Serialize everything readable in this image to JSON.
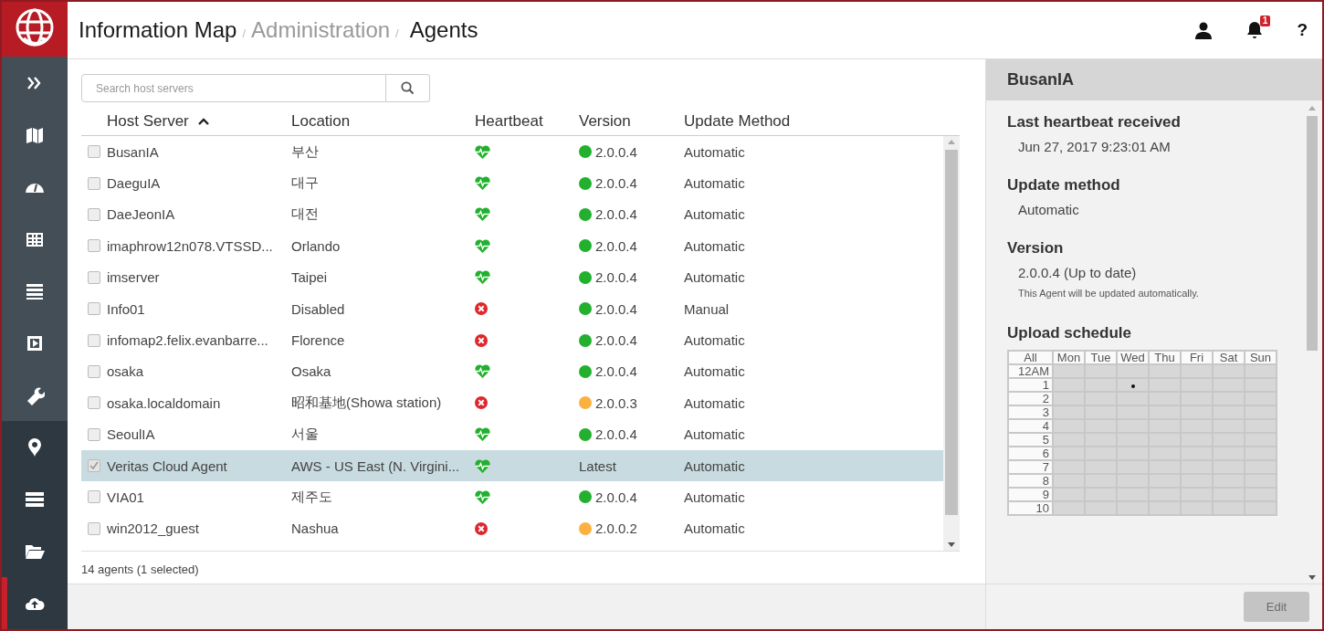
{
  "header": {
    "app_name": "Information Map",
    "separator": "/",
    "breadcrumbs": [
      {
        "label": "Administration",
        "current": false
      },
      {
        "label": "Agents",
        "current": true
      }
    ],
    "notification_count": "1",
    "help_label": "?"
  },
  "sidebar": {
    "groups": [
      {
        "items": [
          {
            "selected": false
          },
          {
            "selected": false
          },
          {
            "selected": false
          },
          {
            "selected": false
          },
          {
            "selected": false
          },
          {
            "selected": false
          },
          {
            "selected": false
          }
        ]
      },
      {
        "items": [
          {
            "selected": false
          },
          {
            "selected": false
          },
          {
            "selected": false
          },
          {
            "selected": true
          }
        ]
      }
    ]
  },
  "search": {
    "placeholder": "Search host servers"
  },
  "table": {
    "columns": [
      {
        "label": "Host Server",
        "sorted": true
      },
      {
        "label": "Location",
        "sorted": false
      },
      {
        "label": "Heartbeat",
        "sorted": false
      },
      {
        "label": "Version",
        "sorted": false
      },
      {
        "label": "Update Method",
        "sorted": false
      }
    ],
    "rows": [
      {
        "host": "BusanIA",
        "location": "부산",
        "alive": true,
        "version": "2.0.0.4",
        "color": "#22b02e",
        "update_method": "Automatic",
        "checked": false,
        "selected": false
      },
      {
        "host": "DaeguIA",
        "location": "대구",
        "alive": true,
        "version": "2.0.0.4",
        "color": "#22b02e",
        "update_method": "Automatic",
        "checked": false,
        "selected": false
      },
      {
        "host": "DaeJeonIA",
        "location": "대전",
        "alive": true,
        "version": "2.0.0.4",
        "color": "#22b02e",
        "update_method": "Automatic",
        "checked": false,
        "selected": false
      },
      {
        "host": "imaphrow12n078.VTSSD...",
        "location": "Orlando",
        "alive": true,
        "version": "2.0.0.4",
        "color": "#22b02e",
        "update_method": "Automatic",
        "checked": false,
        "selected": false
      },
      {
        "host": "imserver",
        "location": "Taipei",
        "alive": true,
        "version": "2.0.0.4",
        "color": "#22b02e",
        "update_method": "Automatic",
        "checked": false,
        "selected": false
      },
      {
        "host": "Info01",
        "location": "Disabled",
        "alive": false,
        "version": "2.0.0.4",
        "color": "#22b02e",
        "update_method": "Manual",
        "checked": false,
        "selected": false
      },
      {
        "host": "infomap2.felix.evanbarre...",
        "location": "Florence",
        "alive": false,
        "version": "2.0.0.4",
        "color": "#22b02e",
        "update_method": "Automatic",
        "checked": false,
        "selected": false
      },
      {
        "host": "osaka",
        "location": "Osaka",
        "alive": true,
        "version": "2.0.0.4",
        "color": "#22b02e",
        "update_method": "Automatic",
        "checked": false,
        "selected": false
      },
      {
        "host": "osaka.localdomain",
        "location": "昭和基地(Showa station)",
        "alive": false,
        "version": "2.0.0.3",
        "color": "#fbb040",
        "update_method": "Automatic",
        "checked": false,
        "selected": false
      },
      {
        "host": "SeoulIA",
        "location": "서울",
        "alive": true,
        "version": "2.0.0.4",
        "color": "#22b02e",
        "update_method": "Automatic",
        "checked": false,
        "selected": false
      },
      {
        "host": "Veritas Cloud Agent",
        "location": "AWS - US East (N. Virgini...",
        "alive": true,
        "version": "Latest",
        "update_method": "Automatic",
        "checked": true,
        "selected": true
      },
      {
        "host": "VIA01",
        "location": "제주도",
        "alive": true,
        "version": "2.0.0.4",
        "color": "#22b02e",
        "update_method": "Automatic",
        "checked": false,
        "selected": false
      },
      {
        "host": "win2012_guest",
        "location": "Nashua",
        "alive": false,
        "version": "2.0.0.2",
        "color": "#fbb040",
        "update_method": "Automatic",
        "checked": false,
        "selected": false
      }
    ],
    "summary": "14 agents (1 selected)"
  },
  "details": {
    "title": "BusanIA",
    "sections": [
      {
        "heading": "Last heartbeat received",
        "value": "Jun 27, 2017 9:23:01 AM"
      },
      {
        "heading": "Update method",
        "value": "Automatic"
      },
      {
        "heading": "Version",
        "value": "2.0.0.4 (Up to date)",
        "note": "This Agent will be updated automatically."
      }
    ],
    "schedule": {
      "heading": "Upload schedule",
      "corner": "All",
      "days": [
        "Mon",
        "Tue",
        "Wed",
        "Thu",
        "Fri",
        "Sat",
        "Sun"
      ],
      "hours": [
        {
          "label": "12AM",
          "marked": [
            false,
            false,
            false,
            false,
            false,
            false,
            false
          ]
        },
        {
          "label": "1",
          "marked": [
            false,
            false,
            true,
            false,
            false,
            false,
            false
          ]
        },
        {
          "label": "2",
          "marked": [
            false,
            false,
            false,
            false,
            false,
            false,
            false
          ]
        },
        {
          "label": "3",
          "marked": [
            false,
            false,
            false,
            false,
            false,
            false,
            false
          ]
        },
        {
          "label": "4",
          "marked": [
            false,
            false,
            false,
            false,
            false,
            false,
            false
          ]
        },
        {
          "label": "5",
          "marked": [
            false,
            false,
            false,
            false,
            false,
            false,
            false
          ]
        },
        {
          "label": "6",
          "marked": [
            false,
            false,
            false,
            false,
            false,
            false,
            false
          ]
        },
        {
          "label": "7",
          "marked": [
            false,
            false,
            false,
            false,
            false,
            false,
            false
          ]
        },
        {
          "label": "8",
          "marked": [
            false,
            false,
            false,
            false,
            false,
            false,
            false
          ]
        },
        {
          "label": "9",
          "marked": [
            false,
            false,
            false,
            false,
            false,
            false,
            false
          ]
        },
        {
          "label": "10",
          "marked": [
            false,
            false,
            false,
            false,
            false,
            false,
            false
          ]
        }
      ]
    },
    "edit_button": {
      "label": "Edit",
      "disabled": true
    }
  }
}
